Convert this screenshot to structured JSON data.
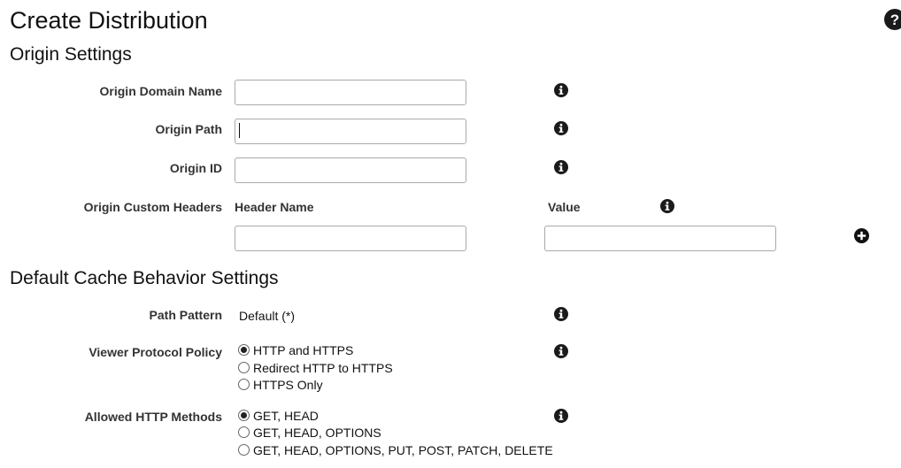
{
  "page": {
    "title": "Create Distribution",
    "help_icon": "question-circle-icon"
  },
  "origin_settings": {
    "heading": "Origin Settings",
    "fields": [
      {
        "label": "Origin Domain Name",
        "value": ""
      },
      {
        "label": "Origin Path",
        "value": ""
      },
      {
        "label": "Origin ID",
        "value": ""
      }
    ],
    "custom_headers": {
      "label": "Origin Custom Headers",
      "header_name_label": "Header Name",
      "value_label": "Value",
      "header_name_value": "",
      "value_value": ""
    }
  },
  "cache_behavior": {
    "heading": "Default Cache Behavior Settings",
    "path_pattern": {
      "label": "Path Pattern",
      "value": "Default (*)"
    },
    "viewer_protocol_policy": {
      "label": "Viewer Protocol Policy",
      "options": [
        "HTTP and HTTPS",
        "Redirect HTTP to HTTPS",
        "HTTPS Only"
      ],
      "selected": "HTTP and HTTPS"
    },
    "allowed_http_methods": {
      "label": "Allowed HTTP Methods",
      "options": [
        "GET, HEAD",
        "GET, HEAD, OPTIONS",
        "GET, HEAD, OPTIONS, PUT, POST, PATCH, DELETE"
      ],
      "selected": "GET, HEAD"
    }
  },
  "colors": {
    "icon": "#1a1a1a",
    "input_border": "#aaaaaa",
    "label": "#333333"
  }
}
